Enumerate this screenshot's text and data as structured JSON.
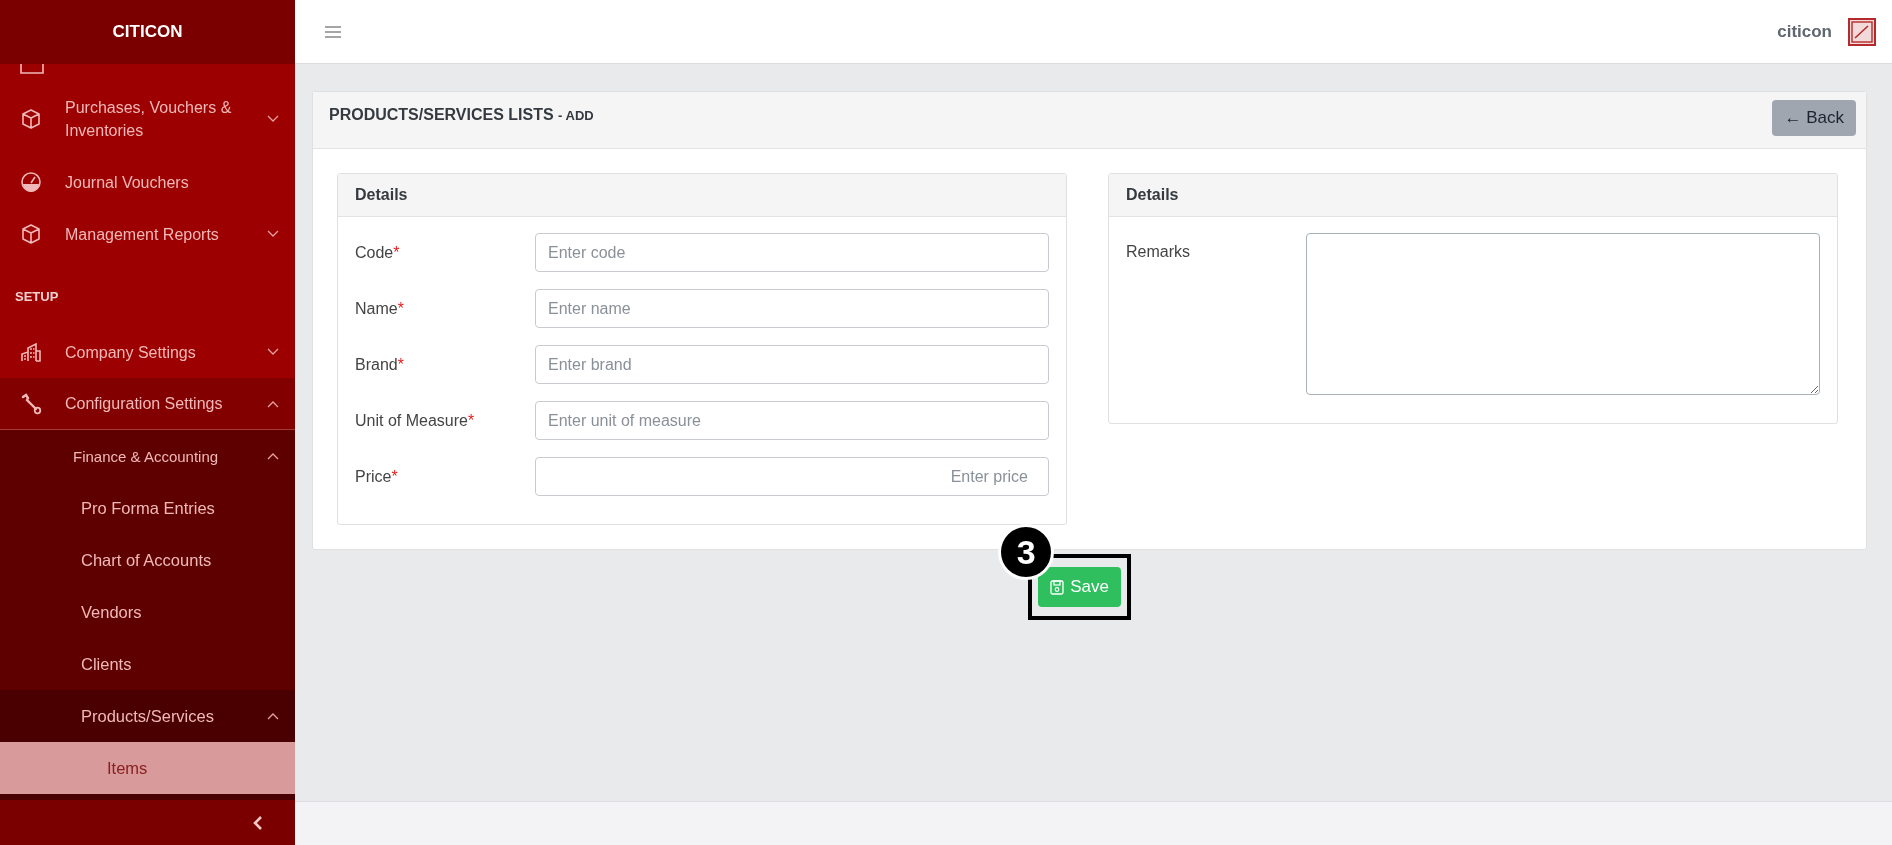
{
  "brand": "CITICON",
  "sidebar": {
    "items": [
      {
        "kind": "group",
        "label": "Purchases, Vouchers & Inventories",
        "expanded": false
      },
      {
        "kind": "link",
        "label": "Journal Vouchers",
        "selected": false
      },
      {
        "kind": "group",
        "label": "Management Reports",
        "expanded": false
      },
      {
        "kind": "heading",
        "label": "SETUP"
      },
      {
        "kind": "group",
        "label": "Company Settings",
        "expanded": false
      },
      {
        "kind": "group",
        "label": "Configuration Settings",
        "expanded": true,
        "children": [
          {
            "kind": "group",
            "label": "Finance & Accounting",
            "expanded": true,
            "children": [
              {
                "kind": "link",
                "label": "Pro Forma Entries",
                "selected": false
              },
              {
                "kind": "link",
                "label": "Chart of Accounts",
                "selected": false
              },
              {
                "kind": "link",
                "label": "Vendors",
                "selected": false
              },
              {
                "kind": "link",
                "label": "Clients",
                "selected": false
              },
              {
                "kind": "group",
                "label": "Products/Services",
                "expanded": true,
                "children": [
                  {
                    "kind": "link",
                    "label": "Items",
                    "selected": true
                  }
                ]
              }
            ]
          }
        ]
      }
    ]
  },
  "header": {
    "user": "citicon"
  },
  "page": {
    "title": "PRODUCTS/SERVICES LISTS",
    "subtitle": "- ADD",
    "back_button": "← Back"
  },
  "left_panel": {
    "title": "Details",
    "fields": [
      {
        "kind": "text",
        "label": "Code",
        "required_mark": "*",
        "placeholder": "Enter code"
      },
      {
        "kind": "text",
        "label": "Name",
        "required_mark": "*",
        "placeholder": "Enter name"
      },
      {
        "kind": "text",
        "label": "Brand",
        "required_mark": "*",
        "placeholder": "Enter brand"
      },
      {
        "kind": "text",
        "label": "Unit of Measure",
        "required_mark": "*",
        "placeholder": "Enter unit of measure"
      },
      {
        "kind": "number",
        "label": "Price",
        "required_mark": "*",
        "placeholder": "Enter price"
      }
    ]
  },
  "right_panel": {
    "title": "Details",
    "fields": [
      {
        "label": "Remarks",
        "kind": "textarea"
      }
    ]
  },
  "save_button": "Save",
  "annotation": {
    "number": "3"
  }
}
